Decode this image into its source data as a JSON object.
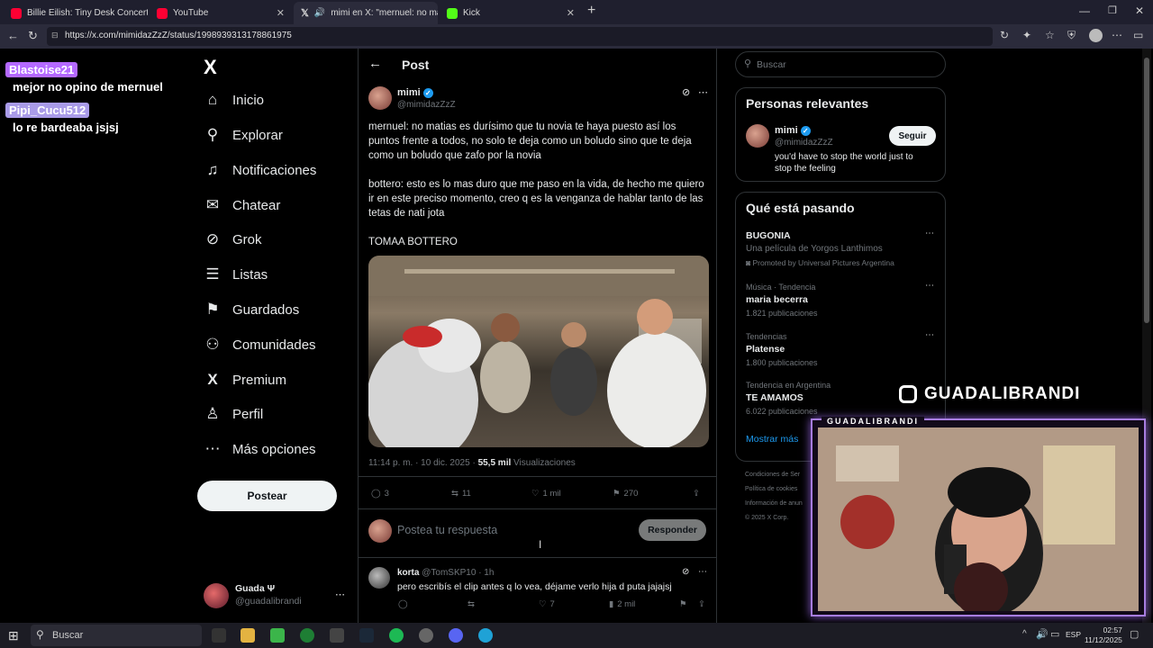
{
  "browser": {
    "tabs": [
      {
        "label": "Billie Eilish: Tiny Desk Concert - Yo",
        "fav": "#ff0033",
        "close": "✕"
      },
      {
        "label": "YouTube",
        "fav": "#ff0033",
        "close": "✕"
      },
      {
        "label": "mimi en X: \"mernuel: no matia",
        "fav": "#ffffff",
        "close": "✕"
      },
      {
        "label": "Kick",
        "fav": "#53fc18",
        "close": "✕"
      }
    ],
    "new_tab": "+",
    "url": "https://x.com/mimidazZzZ/status/1998939313178861975"
  },
  "chat": [
    {
      "user": "Blastoise21",
      "color": "#b469ff",
      "msg": "mejor no opino de mernuel"
    },
    {
      "user": "Pipi_Cucu512",
      "color": "#b9a6ff",
      "msg": "lo re bardeaba jsjsj"
    }
  ],
  "sidebar": {
    "logo": "X",
    "items": [
      {
        "label": "Inicio",
        "icon": "⌂"
      },
      {
        "label": "Explorar",
        "icon": "⚲"
      },
      {
        "label": "Notificaciones",
        "icon": "♫"
      },
      {
        "label": "Chatear",
        "icon": "✉"
      },
      {
        "label": "Grok",
        "icon": "⊘"
      },
      {
        "label": "Listas",
        "icon": "☰"
      },
      {
        "label": "Guardados",
        "icon": "⚑"
      },
      {
        "label": "Comunidades",
        "icon": "⚇"
      },
      {
        "label": "Premium",
        "icon": "X"
      },
      {
        "label": "Perfil",
        "icon": "♙"
      },
      {
        "label": "Más opciones",
        "icon": "⋯"
      }
    ],
    "post_button": "Postear",
    "account": {
      "name": "Guada Ψ",
      "handle": "@guadalibrandi"
    }
  },
  "post": {
    "header": "Post",
    "author": {
      "name": "mimi",
      "handle": "@mimidazZzZ"
    },
    "paragraphs": [
      "mernuel: no matias es durísimo que tu novia te haya puesto así los puntos frente a todos, no solo te deja como un boludo sino que te deja como un boludo que zafo por la novia",
      "bottero: esto es lo mas duro que me paso en la vida, de hecho me quiero ir en este preciso momento, creo q es la venganza de hablar tanto de las tetas de nati jota",
      "TOMAA BOTTERO"
    ],
    "meta_time": "11:14 p. m. · 10 dic. 2025 ·",
    "views_count": "55,5 mil",
    "views_label": "Visualizaciones",
    "stats": {
      "replies": "3",
      "reposts": "11",
      "likes": "1 mil",
      "bookmarks": "270"
    },
    "reply_placeholder": "Postea tu respuesta",
    "reply_button": "Responder"
  },
  "reply": {
    "name": "korta",
    "handle": "@TomSKP10",
    "time": "· 1h",
    "text": "pero escribís el clip antes q lo vea, déjame verlo hija d puta jajajsj",
    "stats": {
      "reposts": "",
      "likes": "7",
      "views": "2 mil"
    }
  },
  "right": {
    "search_placeholder": "Buscar",
    "relevant_title": "Personas relevantes",
    "person": {
      "name": "mimi",
      "handle": "@mimidazZzZ",
      "bio": "you'd have to stop the world just to stop the feeling",
      "follow": "Seguir"
    },
    "trends_title": "Qué está pasando",
    "trends": [
      {
        "top": "",
        "name": "BUGONIA",
        "sub": "Una película de Yorgos Lanthimos",
        "extra": "Promoted by Universal Pictures Argentina"
      },
      {
        "top": "Música · Tendencia",
        "name": "maria becerra",
        "sub": "1.821 publicaciones",
        "extra": ""
      },
      {
        "top": "Tendencias",
        "name": "Platense",
        "sub": "1.800 publicaciones",
        "extra": ""
      },
      {
        "top": "Tendencia en Argentina",
        "name": "TE AMAMOS",
        "sub": "6.022 publicaciones",
        "extra": ""
      }
    ],
    "show_more": "Mostrar más",
    "footer": [
      "Condiciones de Ser",
      "Política de cookies",
      "Información de anun",
      "© 2025 X Corp."
    ]
  },
  "overlay": {
    "insta_name": "GUADALIBRANDI",
    "cam_label": "GUADALIBRANDI"
  },
  "taskbar": {
    "search": "Buscar",
    "lang": "ESP",
    "time": "02:57",
    "date": "11/12/2025"
  }
}
